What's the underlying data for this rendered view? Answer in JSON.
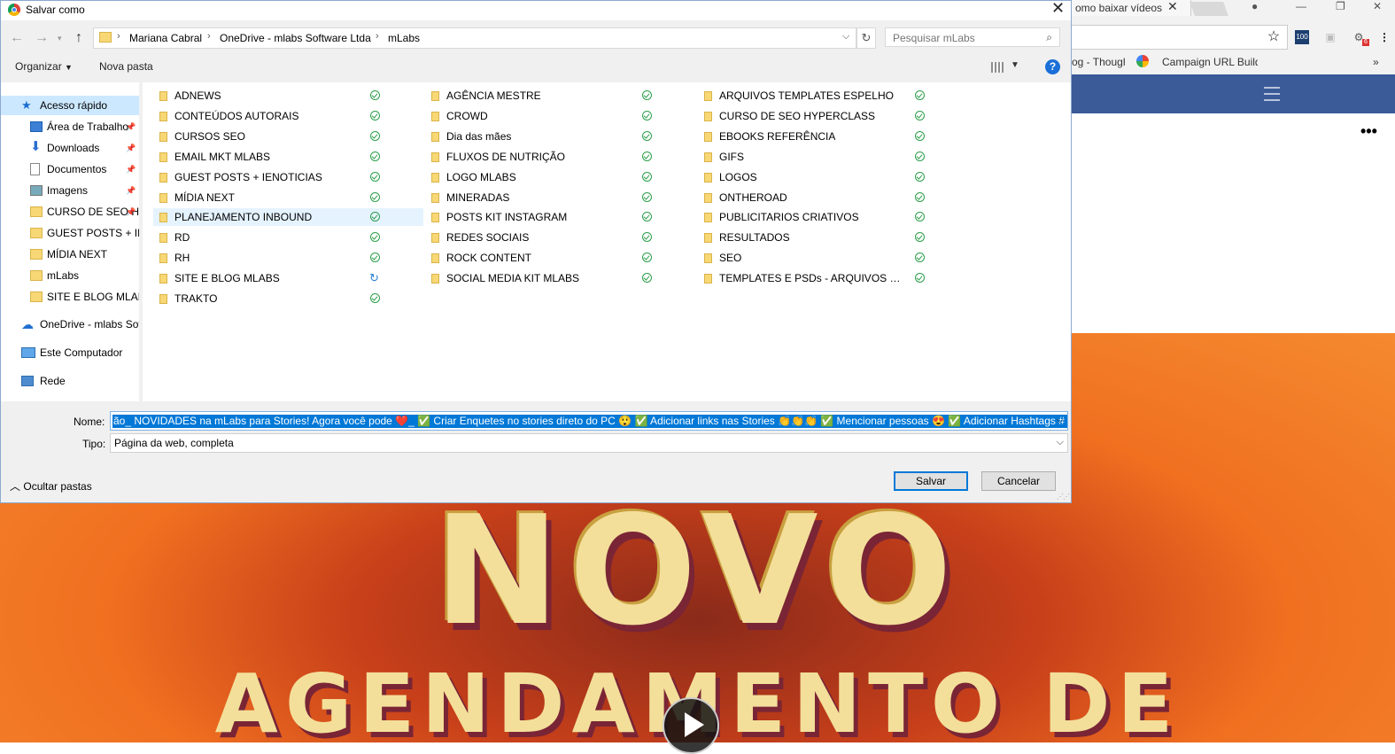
{
  "browser": {
    "tab_title": "omo baixar vídeos",
    "bookmarks": [
      "og - Though",
      "Campaign URL Build"
    ],
    "ext_badge": "100",
    "ext_notif": "6",
    "video": {
      "line1": "NOVO",
      "line2": "AGENDAMENTO DE"
    }
  },
  "dialog": {
    "title": "Salvar como",
    "breadcrumb": [
      "Mariana Cabral",
      "OneDrive - mlabs Software Ltda",
      "mLabs"
    ],
    "search_placeholder": "Pesquisar mLabs",
    "toolbar": {
      "organize": "Organizar",
      "new_folder": "Nova pasta",
      "help": "?"
    },
    "sidebar": [
      {
        "label": "Acesso rápido",
        "icon": "star-icon",
        "selected": true
      },
      {
        "label": "Área de Trabalho",
        "icon": "desktop-icon",
        "pinned": true
      },
      {
        "label": "Downloads",
        "icon": "download-icon",
        "pinned": true
      },
      {
        "label": "Documentos",
        "icon": "document-icon",
        "pinned": true
      },
      {
        "label": "Imagens",
        "icon": "images-icon",
        "pinned": true
      },
      {
        "label": "CURSO DE SEO H",
        "icon": "folder-icon",
        "pinned": true
      },
      {
        "label": "GUEST POSTS + IEN",
        "icon": "folder-icon"
      },
      {
        "label": "MÍDIA NEXT",
        "icon": "folder-icon"
      },
      {
        "label": "mLabs",
        "icon": "folder-icon"
      },
      {
        "label": "SITE E BLOG MLABS",
        "icon": "folder-icon"
      },
      {
        "label": "OneDrive - mlabs Sof",
        "icon": "onedrive-icon"
      },
      {
        "label": "Este Computador",
        "icon": "computer-icon"
      },
      {
        "label": "Rede",
        "icon": "network-icon"
      }
    ],
    "columns": [
      [
        {
          "name": "ADNEWS",
          "status": "synced"
        },
        {
          "name": "CONTEÚDOS AUTORAIS",
          "status": "synced"
        },
        {
          "name": "CURSOS SEO",
          "status": "synced"
        },
        {
          "name": "EMAIL MKT MLABS",
          "status": "synced"
        },
        {
          "name": "GUEST POSTS + IENOTICIAS",
          "status": "synced"
        },
        {
          "name": "MÍDIA NEXT",
          "status": "synced"
        },
        {
          "name": "PLANEJAMENTO INBOUND",
          "status": "synced",
          "highlight": true
        },
        {
          "name": "RD",
          "status": "synced"
        },
        {
          "name": "RH",
          "status": "synced"
        },
        {
          "name": "SITE E BLOG MLABS",
          "status": "syncing"
        },
        {
          "name": "TRAKTO",
          "status": "synced"
        }
      ],
      [
        {
          "name": "AGÊNCIA MESTRE",
          "status": "synced"
        },
        {
          "name": "CROWD",
          "status": "synced"
        },
        {
          "name": "Dia das mães",
          "status": "synced"
        },
        {
          "name": "FLUXOS DE NUTRIÇÃO",
          "status": "synced"
        },
        {
          "name": "LOGO MLABS",
          "status": "synced"
        },
        {
          "name": "MINERADAS",
          "status": "synced"
        },
        {
          "name": "POSTS KIT INSTAGRAM",
          "status": "synced"
        },
        {
          "name": "REDES SOCIAIS",
          "status": "synced"
        },
        {
          "name": "ROCK CONTENT",
          "status": "synced"
        },
        {
          "name": "SOCIAL MEDIA KIT MLABS",
          "status": "synced"
        }
      ],
      [
        {
          "name": "ARQUIVOS TEMPLATES ESPELHO",
          "status": "synced"
        },
        {
          "name": "CURSO DE SEO HYPERCLASS",
          "status": "synced"
        },
        {
          "name": "EBOOKS REFERÊNCIA",
          "status": "synced"
        },
        {
          "name": "GIFS",
          "status": "synced"
        },
        {
          "name": "LOGOS",
          "status": "synced"
        },
        {
          "name": "ONTHEROAD",
          "status": "synced"
        },
        {
          "name": "PUBLICITARIOS CRIATIVOS",
          "status": "synced"
        },
        {
          "name": "RESULTADOS",
          "status": "synced"
        },
        {
          "name": "SEO",
          "status": "synced"
        },
        {
          "name": "TEMPLATES E PSDs - ARQUIVOS NA...",
          "status": "synced"
        }
      ]
    ],
    "name_label": "Nome:",
    "name_value": "ão_ NOVIDADES na mLabs para Stories! Agora você pode ❤️_ ✅ Criar Enquetes no stories direto do PC 😲 ✅ Adicionar links nas Stories 👏👏👏 ✅ Mencionar pessoas 😍 ✅ Adicionar Hashtags # ✅ l.html",
    "type_label": "Tipo:",
    "type_value": "Página da web, completa",
    "hide_folders": "Ocultar pastas",
    "save": "Salvar",
    "cancel": "Cancelar"
  }
}
